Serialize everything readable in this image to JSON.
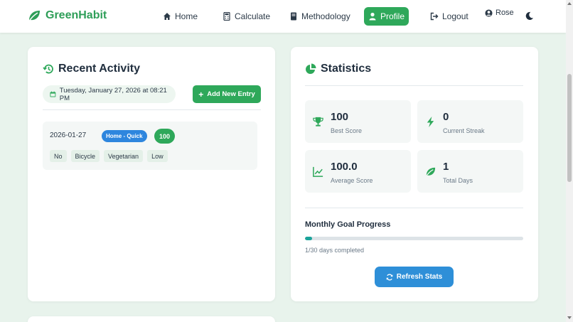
{
  "nav": {
    "brand": "GreenHabit",
    "items": [
      {
        "label": "Home",
        "icon": "home-icon"
      },
      {
        "label": "Calculate",
        "icon": "calculator-icon"
      },
      {
        "label": "Methodology",
        "icon": "book-icon"
      },
      {
        "label": "Profile",
        "icon": "user-icon",
        "active": true
      },
      {
        "label": "Logout",
        "icon": "logout-icon"
      }
    ],
    "user": "Rose",
    "theme_icon": "moon-icon"
  },
  "activity": {
    "title": "Recent Activity",
    "date": "Tuesday, January 27, 2026 at 08:21 PM",
    "add_label": "Add New Entry",
    "entries": [
      {
        "date": "2026-01-27",
        "type": "Home - Quick",
        "score": "100",
        "tags": [
          "No",
          "Bicycle",
          "Vegetarian",
          "Low"
        ]
      }
    ]
  },
  "stats": {
    "title": "Statistics",
    "items": [
      {
        "value": "100",
        "label": "Best Score",
        "icon": "trophy-icon"
      },
      {
        "value": "0",
        "label": "Current Streak",
        "icon": "bolt-icon"
      },
      {
        "value": "100.0",
        "label": "Average Score",
        "icon": "chart-line-icon"
      },
      {
        "value": "1",
        "label": "Total Days",
        "icon": "leaf-icon"
      }
    ],
    "goal_title": "Monthly Goal Progress",
    "goal_progress": 0.0333,
    "goal_text": "1/30 days completed",
    "refresh_label": "Refresh Stats"
  },
  "colors": {
    "primary_green": "#2ea85a",
    "accent_blue": "#2e8fd8",
    "badge_blue": "#2e86de",
    "progress_teal": "#1aa39a",
    "page_bg": "#e8f3ec"
  }
}
